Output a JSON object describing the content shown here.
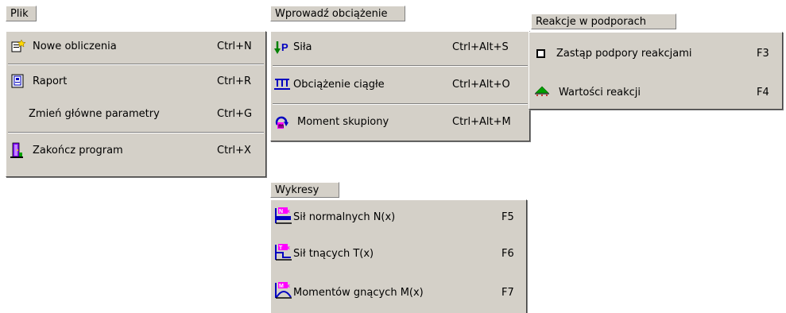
{
  "menus": {
    "plik": {
      "title": "Plik",
      "items": [
        {
          "icon": "new-document-icon",
          "label": "Nowe obliczenia",
          "shortcut": "Ctrl+N"
        },
        {
          "icon": "report-icon",
          "label": "Raport",
          "shortcut": "Ctrl+R"
        },
        {
          "icon": "",
          "label": "Zmień główne parametry",
          "shortcut": "Ctrl+G"
        },
        {
          "icon": "exit-icon",
          "label": "Zakończ program",
          "shortcut": "Ctrl+X"
        }
      ]
    },
    "obciazenie": {
      "title": "Wprowadź obciążenie",
      "items": [
        {
          "icon": "force-arrow-icon",
          "label": "Siła",
          "shortcut": "Ctrl+Alt+S"
        },
        {
          "icon": "distributed-load-icon",
          "label": "Obciążenie ciągłe",
          "shortcut": "Ctrl+Alt+O"
        },
        {
          "icon": "moment-icon",
          "label": "Moment skupiony",
          "shortcut": "Ctrl+Alt+M"
        }
      ]
    },
    "reakcje": {
      "title": "Reakcje w podporach",
      "items": [
        {
          "icon": "square-icon",
          "label": "Zastąp podpory reakcjami",
          "shortcut": "F3"
        },
        {
          "icon": "support-reaction-icon",
          "label": "Wartości reakcji",
          "shortcut": "F4"
        }
      ]
    },
    "wykresy": {
      "title": "Wykresy",
      "items": [
        {
          "icon": "normal-force-chart-icon",
          "label": "Sił normalnych N(x)",
          "shortcut": "F5"
        },
        {
          "icon": "shear-force-chart-icon",
          "label": "Sił tnących T(x)",
          "shortcut": "F6"
        },
        {
          "icon": "bending-moment-chart-icon",
          "label": "Momentów gnących M(x)",
          "shortcut": "F7"
        }
      ]
    }
  },
  "colors": {
    "menu_bg": "#d4d0c8",
    "highlight_shadow": "#808080",
    "icon_blue": "#0000c0",
    "icon_green": "#008000",
    "icon_red": "#c00000",
    "icon_magenta": "#ff00ff"
  }
}
